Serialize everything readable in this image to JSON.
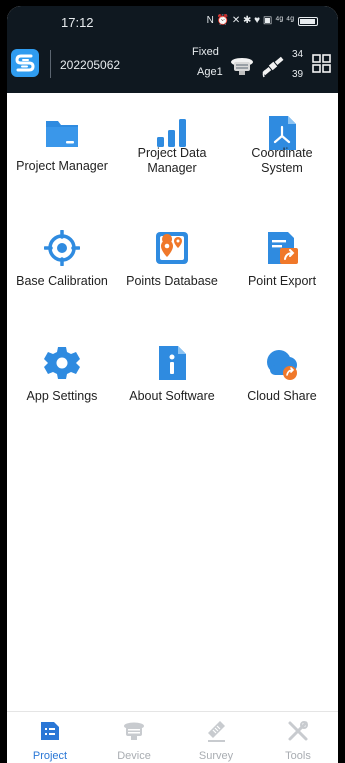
{
  "status_bar": {
    "time": "17:12",
    "icons_text": "N ⏰ ✕ ✱ ♥ ▣ ⁴ᵍ ⁴ᵍ"
  },
  "header": {
    "device_id": "202205062",
    "fix_status": "Fixed",
    "age": "Age1",
    "sat_count_top": "34",
    "sat_count_bottom": "39"
  },
  "menu": [
    {
      "label": "Project Manager",
      "icon": "folder-icon"
    },
    {
      "label": "Project Data\nManager",
      "icon": "bar-chart-icon"
    },
    {
      "label": "Coordinate\nSystem",
      "icon": "coordinate-axes-icon"
    },
    {
      "label": "Base Calibration",
      "icon": "target-icon"
    },
    {
      "label": "Points Database",
      "icon": "map-pins-icon"
    },
    {
      "label": "Point Export",
      "icon": "export-document-icon"
    },
    {
      "label": "App Settings",
      "icon": "gear-icon"
    },
    {
      "label": "About Software",
      "icon": "info-icon"
    },
    {
      "label": "Cloud Share",
      "icon": "cloud-share-icon"
    }
  ],
  "bottom_nav": [
    {
      "label": "Project",
      "active": true,
      "icon": "project-icon"
    },
    {
      "label": "Device",
      "active": false,
      "icon": "receiver-icon"
    },
    {
      "label": "Survey",
      "active": false,
      "icon": "survey-icon"
    },
    {
      "label": "Tools",
      "active": false,
      "icon": "tools-icon"
    }
  ],
  "colors": {
    "accent": "#2a77d6",
    "icon_blue": "#2f8be0",
    "header_bg": "#0f1820",
    "orange": "#f0782a"
  }
}
